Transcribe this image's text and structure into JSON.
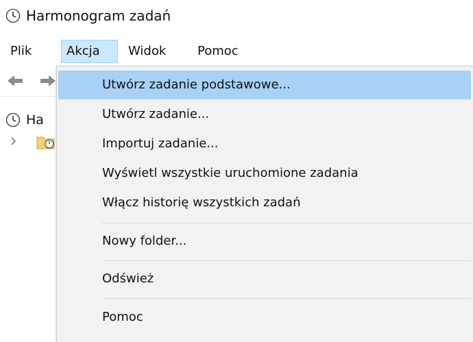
{
  "window": {
    "title": "Harmonogram zadań"
  },
  "menubar": {
    "items": [
      {
        "label": "Plik"
      },
      {
        "label": "Akcja"
      },
      {
        "label": "Widok"
      },
      {
        "label": "Pomoc"
      }
    ],
    "active": "Akcja"
  },
  "toolbar": {
    "icons": [
      "back-arrow-icon",
      "forward-arrow-icon"
    ]
  },
  "tree": {
    "root_label": "Ha",
    "root_icon": "clock-icon",
    "child_icon": "folder-clock-icon"
  },
  "action_menu": {
    "items": [
      {
        "label": "Utwórz zadanie podstawowe..."
      },
      {
        "label": "Utwórz zadanie..."
      },
      {
        "label": "Importuj zadanie..."
      },
      {
        "label": "Wyświetl wszystkie uruchomione zadania"
      },
      {
        "label": "Włącz historię wszystkich zadań"
      },
      {
        "label": "Nowy folder..."
      },
      {
        "label": "Odśwież"
      },
      {
        "label": "Pomoc"
      }
    ],
    "highlighted": "Utwórz zadanie podstawowe..."
  },
  "colors": {
    "menu_highlight": "#a7d1f5",
    "menubar_active": "#cce8ff",
    "dropdown_bg": "#f2f2f2"
  }
}
